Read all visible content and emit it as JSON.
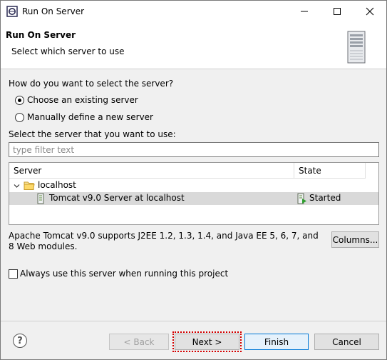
{
  "window": {
    "title": "Run On Server",
    "icon": "eclipse-icon"
  },
  "banner": {
    "title": "Run On Server",
    "subtitle": "Select which server to use",
    "image": "server-tower-icon"
  },
  "selection": {
    "question": "How do you want to select the server?",
    "options": [
      {
        "label": "Choose an existing server",
        "selected": true
      },
      {
        "label": "Manually define a new server",
        "selected": false
      }
    ]
  },
  "server_list": {
    "label": "Select the server that you want to use:",
    "filter_placeholder": "type filter text",
    "filter_value": "",
    "columns": [
      "Server",
      "State"
    ],
    "rows": [
      {
        "name": "localhost",
        "state": "",
        "icon": "folder-icon",
        "expanded": true
      },
      {
        "name": "Tomcat v9.0 Server at localhost",
        "state": "Started",
        "icon": "server-icon",
        "state_icon": "server-started-icon",
        "selected": true
      }
    ]
  },
  "description": "Apache Tomcat v9.0 supports J2EE 1.2, 1.3, 1.4, and Java EE 5, 6, 7, and 8 Web modules.",
  "columns_button": "Columns...",
  "always_use": {
    "label": "Always use this server when running this project",
    "checked": false
  },
  "footer": {
    "back": "< Back",
    "next": "Next >",
    "finish": "Finish",
    "cancel": "Cancel",
    "help": "?"
  }
}
